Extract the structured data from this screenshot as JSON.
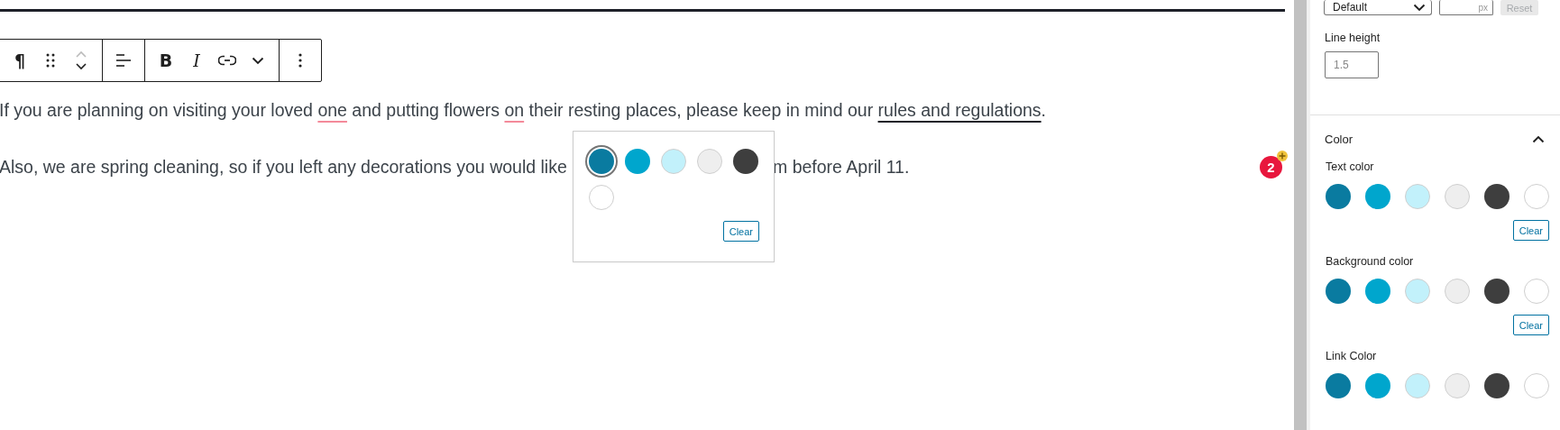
{
  "toolbar": {
    "groups": [
      [
        {
          "kind": "paragraph",
          "label": "¶"
        },
        {
          "kind": "drag"
        },
        {
          "kind": "mover"
        }
      ],
      [
        {
          "kind": "align"
        }
      ],
      [
        {
          "kind": "bold",
          "label": "B"
        },
        {
          "kind": "italic",
          "label": "I"
        },
        {
          "kind": "link"
        },
        {
          "kind": "more"
        }
      ],
      [
        {
          "kind": "options"
        }
      ]
    ]
  },
  "paragraphs": [
    {
      "segments": [
        {
          "text": "If you are planning on visiting your loved ",
          "kind": "plain"
        },
        {
          "text": "one",
          "kind": "misspelled"
        },
        {
          "text": " and putting flowers ",
          "kind": "plain"
        },
        {
          "text": "on",
          "kind": "misspelled"
        },
        {
          "text": " their resting places, please keep in mind our ",
          "kind": "plain"
        },
        {
          "text": "rules and regulations",
          "kind": "link"
        },
        {
          "text": ".",
          "kind": "plain"
        }
      ]
    },
    {
      "visible_parts": [
        "Also, we are spring cleaning, so if you left any decorations you would like",
        "m before April 11."
      ]
    }
  ],
  "notification_badge": {
    "count": "2"
  },
  "color_popover": {
    "swatches": [
      {
        "color": "#0a7ba0",
        "selected": true
      },
      {
        "color": "#00a6cd",
        "selected": false
      },
      {
        "color": "#c2f1fb",
        "selected": false
      },
      {
        "color": "#eeeeee",
        "selected": false
      },
      {
        "color": "#3e3e3e",
        "selected": false
      },
      {
        "color": "#ffffff",
        "selected": false
      }
    ],
    "clear": "Clear"
  },
  "sidebar": {
    "typography": {
      "font_size": "Default",
      "custom_size_unit": "px",
      "reset": {
        "label": "Reset",
        "disabled": true
      },
      "line_height_label": "Line height",
      "line_height_value": "1.5"
    },
    "color_panel": {
      "title": "Color",
      "expanded": true,
      "sections": [
        {
          "label": "Text color",
          "swatches": [
            {
              "color": "#0a7ba0",
              "selected": false
            },
            {
              "color": "#00a6cd",
              "selected": false
            },
            {
              "color": "#c2f1fb",
              "selected": false
            },
            {
              "color": "#eeeeee",
              "selected": false
            },
            {
              "color": "#3e3e3e",
              "selected": false
            },
            {
              "color": "#ffffff",
              "selected": false
            }
          ],
          "clear": "Clear"
        },
        {
          "label": "Background color",
          "swatches": [
            {
              "color": "#0a7ba0",
              "selected": false
            },
            {
              "color": "#00a6cd",
              "selected": false
            },
            {
              "color": "#c2f1fb",
              "selected": false
            },
            {
              "color": "#eeeeee",
              "selected": false
            },
            {
              "color": "#3e3e3e",
              "selected": false
            },
            {
              "color": "#ffffff",
              "selected": false
            }
          ],
          "clear": "Clear"
        },
        {
          "label": "Link Color",
          "swatches": [
            {
              "color": "#0a7ba0",
              "selected": false
            },
            {
              "color": "#00a6cd",
              "selected": false
            },
            {
              "color": "#c2f1fb",
              "selected": false
            },
            {
              "color": "#eeeeee",
              "selected": false
            },
            {
              "color": "#3e3e3e",
              "selected": false
            },
            {
              "color": "#ffffff",
              "selected": false
            }
          ]
        }
      ]
    }
  }
}
